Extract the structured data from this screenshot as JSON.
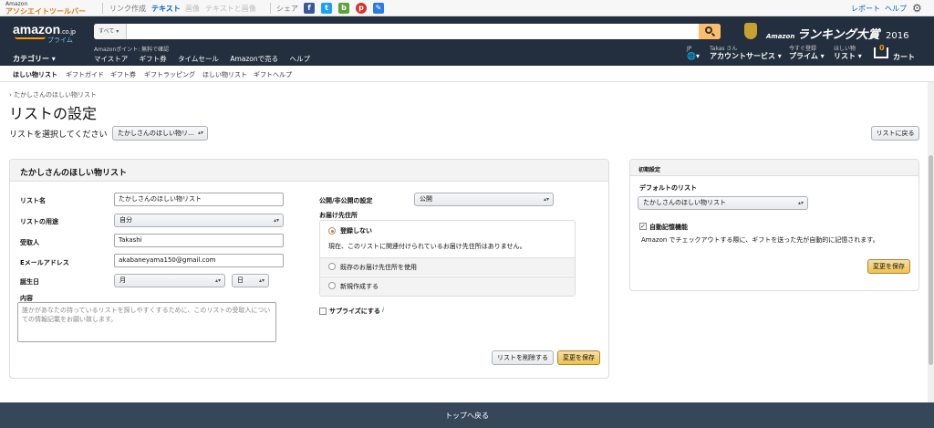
{
  "assoc_bar": {
    "brand_line1": "Amazon",
    "brand_line2": "アソシエイトツールバー",
    "link_create": "リンク作成",
    "text": "テキスト",
    "image": "画像",
    "text_image": "テキストと画像",
    "share": "シェア",
    "report": "レポート",
    "help": "ヘルプ"
  },
  "header": {
    "logo": "amazon",
    "logo_suffix": ".co.jp",
    "logo_prime": "プライム",
    "search_category": "すべて",
    "ranking_small": "Amazon",
    "ranking_big": "ランキング大賞",
    "ranking_year": "2016",
    "category_menu": "カテゴリー",
    "points": "Amazonポイント: 無料で確認",
    "nav_links": [
      "マイストア",
      "ギフト券",
      "タイムセール",
      "Amazonで売る",
      "ヘルプ"
    ],
    "lang_small": "JP",
    "account_small": "Takas さん",
    "account_big": "アカウントサービス",
    "prime_small": "今すぐ登録",
    "prime_big": "プライム",
    "list_small": "ほしい物",
    "list_big": "リスト",
    "cart_count": "0",
    "cart": "カート"
  },
  "subnav": [
    "ほしい物リスト",
    "ギフトガイド",
    "ギフト券",
    "ギフトラッピング",
    "ほしい物リスト",
    "ギフトヘルプ"
  ],
  "breadcrumb": "› たかしさんのほしい物リスト",
  "page_title": "リストの設定",
  "list_select_label": "リストを選択してください",
  "list_select_value": "たかしさんのほしい物リ…",
  "back_button": "リストに戻る",
  "main_panel": {
    "title": "たかしさんのほしい物リスト",
    "fields": {
      "list_name_label": "リスト名",
      "list_name_value": "たかしさんのほしい物リスト",
      "usage_label": "リストの用途",
      "usage_value": "自分",
      "recipient_label": "受取人",
      "recipient_value": "Takashi",
      "email_label": "Eメールアドレス",
      "email_value": "akabaneyama150@gmail.com",
      "birthday_label": "誕生日",
      "month_value": "月",
      "day_value": "日",
      "content_label": "内容",
      "content_placeholder": "誰かがあなたの持っているリストを探しやすくするために、このリストの受取人についての情報記載をお願い致します。"
    },
    "privacy_label": "公開/非公開の設定",
    "privacy_value": "公開",
    "address_label": "お届け先住所",
    "address_options": [
      {
        "label": "登録しない",
        "note": "現在、このリストに関連付けられているお届け先住所はありません。"
      },
      {
        "label": "既存のお届け先住所を使用"
      },
      {
        "label": "新規作成する"
      }
    ],
    "surprise_label": "サプライズにする",
    "info_icon": "i",
    "delete_button": "リストを削除する",
    "save_button": "変更を保存"
  },
  "side_panel": {
    "title": "初期設定",
    "default_label": "デフォルトのリスト",
    "default_value": "たかしさんのほしい物リスト",
    "auto_memory_label": "自動記憶機能",
    "auto_memory_desc": "Amazon でチェックアウトする際に、ギフトを送った先が自動的に記憶されます。",
    "save_button": "変更を保存"
  },
  "footer": "トップへ戻る",
  "colors": {
    "header_bg": "#232f3e",
    "footer_bg": "#37475a",
    "search_button": "#febd69",
    "primary_button": "#f0c14b",
    "link": "#0066c0"
  }
}
